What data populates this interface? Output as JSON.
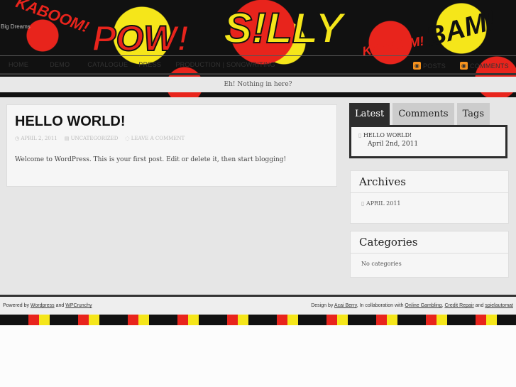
{
  "header": {
    "tagline": "Big Dreams",
    "art_words": [
      "KABOOM!",
      "POW!",
      "S!LLY",
      "BAM!",
      "KABOOM!"
    ]
  },
  "nav": {
    "items": [
      "HOME",
      "DEMO",
      "CATALOGUE",
      "PRESS",
      "PRODUCTION | SONGWRITING"
    ],
    "rss": [
      "POSTS",
      "COMMENTS"
    ]
  },
  "notice": "Eh! Nothing in here?",
  "post": {
    "title": "HELLO WORLD!",
    "date": "APRIL 2, 2011",
    "category": "UNCATEGORIZED",
    "comments": "LEAVE A COMMENT",
    "body": "Welcome to WordPress. This is your first post. Edit or delete it, then start blogging!"
  },
  "sidebar": {
    "tabs": [
      "Latest",
      "Comments",
      "Tags"
    ],
    "latest": {
      "title": "HELLO WORLD!",
      "date": "April 2nd, 2011"
    },
    "archives": {
      "title": "Archives",
      "items": [
        "APRIL 2011"
      ]
    },
    "categories": {
      "title": "Categories",
      "empty": "No categories"
    }
  },
  "footer": {
    "powered": "Powered by",
    "wordpress": "Wordpress",
    "and": "and",
    "wpcrunchy": "WPCrunchy",
    "design": "Design by",
    "acai": "Acai Berry",
    "collab": ", In collaboration with",
    "gambling": "Online Gambling",
    "credit": "Credit Repair",
    "and2": "and",
    "spiel": "spielautomat"
  }
}
